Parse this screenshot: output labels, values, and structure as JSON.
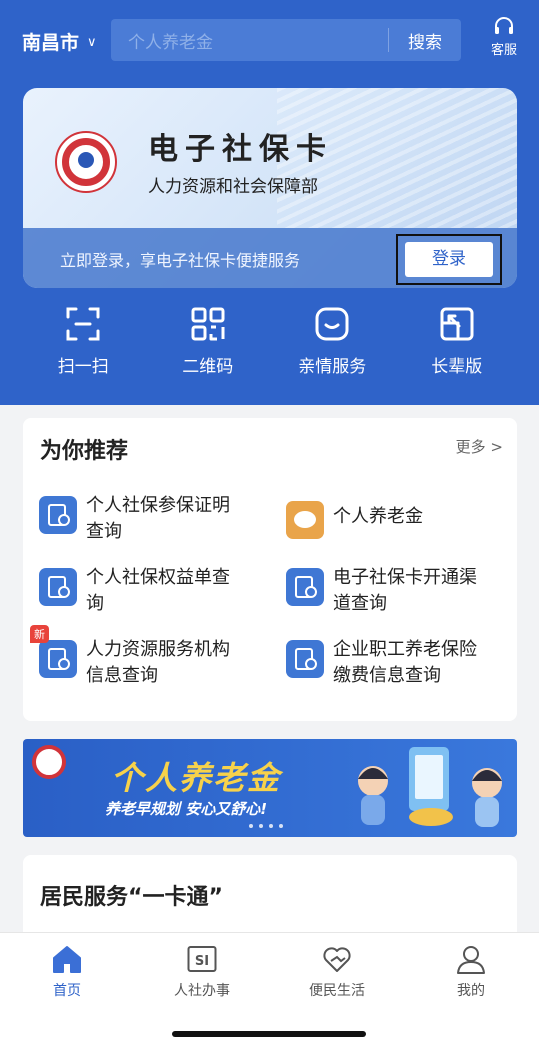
{
  "header": {
    "city": "南昌市",
    "search_placeholder": "个人养老金",
    "search_button": "搜索",
    "customer_service": "客服"
  },
  "card": {
    "title": "电子社保卡",
    "subtitle": "人力资源和社会保障部",
    "prompt": "立即登录，享电子社保卡便捷服务",
    "login_button": "登录"
  },
  "quick_actions": [
    {
      "label": "扫一扫",
      "icon": "scan-icon"
    },
    {
      "label": "二维码",
      "icon": "qrcode-icon"
    },
    {
      "label": "亲情服务",
      "icon": "family-service-icon"
    },
    {
      "label": "长辈版",
      "icon": "elder-mode-icon"
    }
  ],
  "recommend": {
    "title": "为你推荐",
    "more": "更多 >",
    "items": [
      {
        "line1": "个人社保参保证明",
        "line2": "查询",
        "icon": "document-search-icon"
      },
      {
        "line1": "个人养老金",
        "line2": "",
        "icon": "piggy-bank-icon"
      },
      {
        "line1": "个人社保权益单查",
        "line2": "询",
        "icon": "document-search-icon"
      },
      {
        "line1": "电子社保卡开通渠",
        "line2": "道查询",
        "icon": "card-search-icon"
      },
      {
        "line1": "人力资源服务机构",
        "line2": "信息查询",
        "icon": "document-search-icon",
        "badge": "新"
      },
      {
        "line1": "企业职工养老保险",
        "line2": "缴费信息查询",
        "icon": "document-search-icon"
      }
    ]
  },
  "banner": {
    "title": "个人养老金",
    "slogan": "养老早规划 安心又舒心!"
  },
  "resident": {
    "title": "居民服务“一卡通”"
  },
  "tabbar": {
    "items": [
      {
        "label": "首页",
        "icon": "home-icon",
        "active": true
      },
      {
        "label": "人社办事",
        "icon": "si-icon",
        "active": false
      },
      {
        "label": "便民生活",
        "icon": "heart-icon",
        "active": false
      },
      {
        "label": "我的",
        "icon": "person-icon",
        "active": false
      }
    ]
  },
  "colors": {
    "primary": "#2f63c9",
    "badge_red": "#e8433b",
    "banner_yellow": "#f7d24b"
  }
}
